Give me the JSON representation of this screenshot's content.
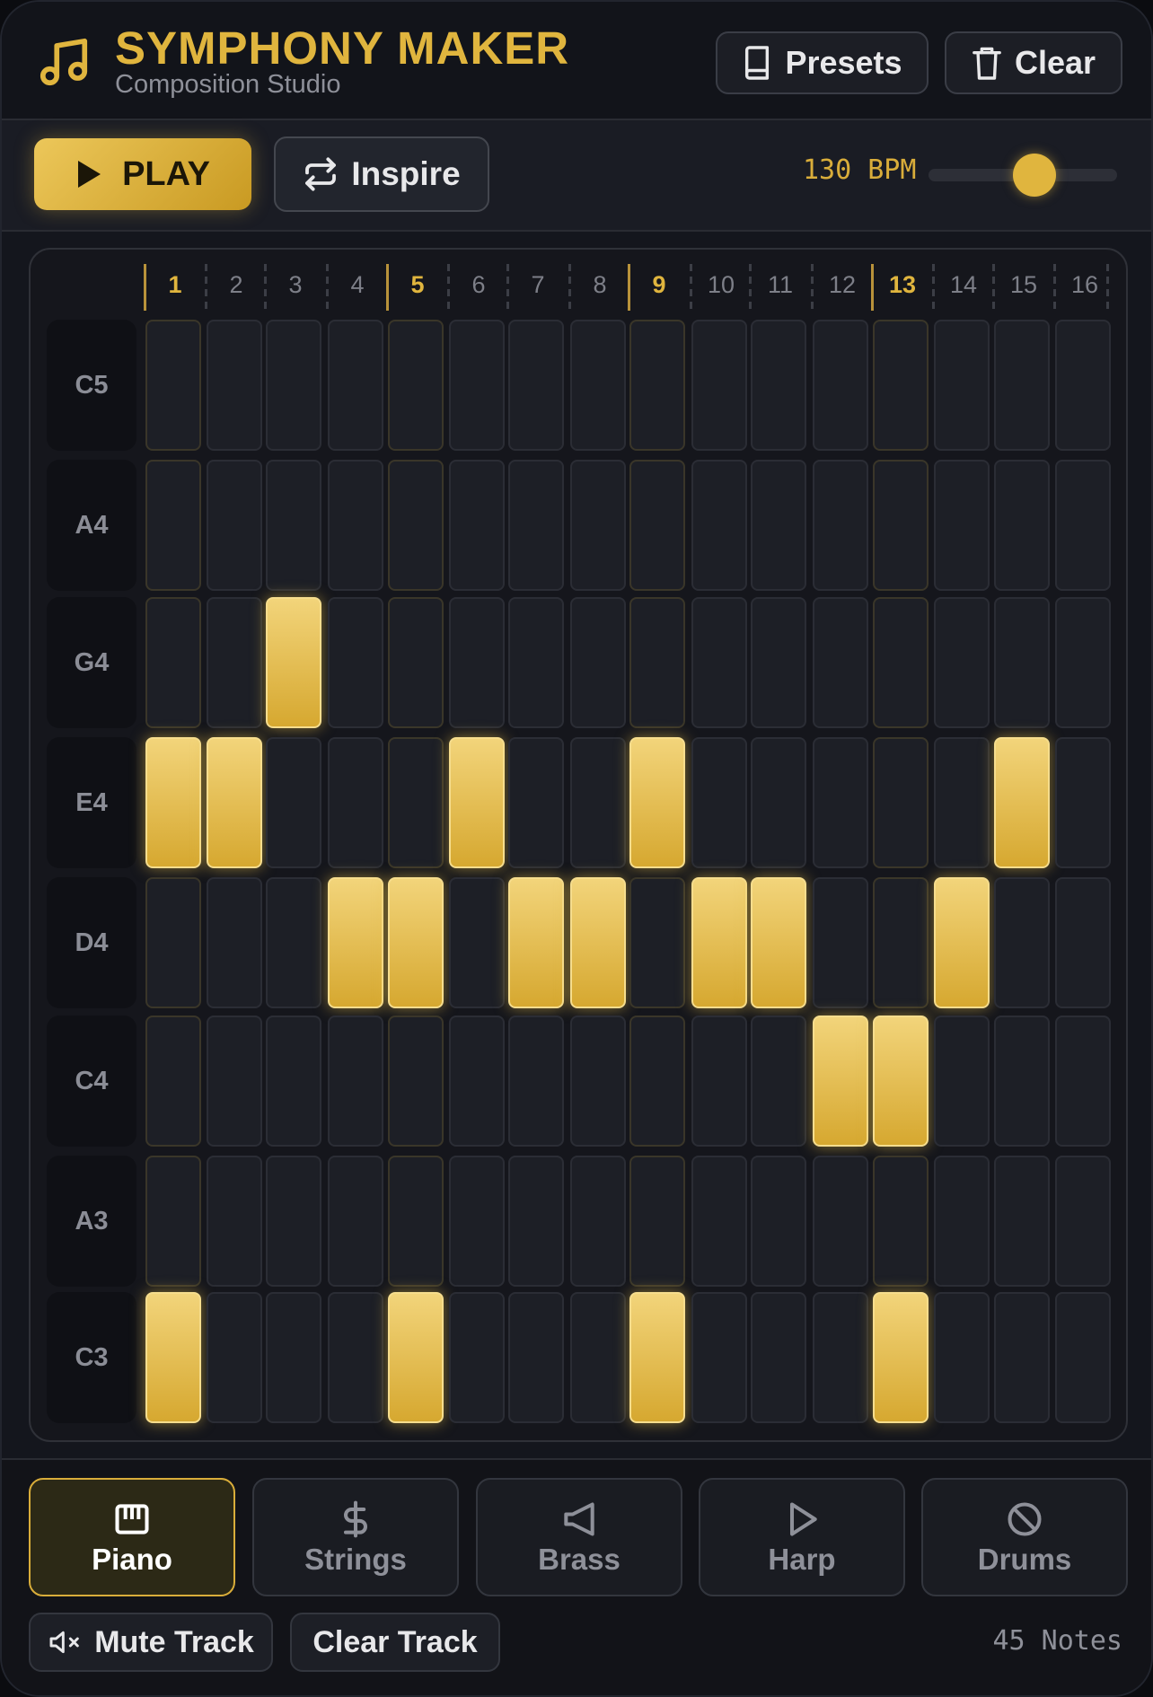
{
  "app": {
    "title": "SYMPHONY MAKER",
    "subtitle": "Composition Studio",
    "logo_icon": "music-note-icon",
    "accent_color": "#e0b53e"
  },
  "header_buttons": {
    "presets": {
      "label": "Presets",
      "icon": "book-icon"
    },
    "clear": {
      "label": "Clear",
      "icon": "trash-icon"
    }
  },
  "toolbar": {
    "play_label": "PLAY",
    "inspire_label": "Inspire",
    "bpm_label": "130 BPM",
    "tempo_fraction": 0.56
  },
  "sequencer": {
    "steps": [
      "1",
      "2",
      "3",
      "4",
      "5",
      "6",
      "7",
      "8",
      "9",
      "10",
      "11",
      "12",
      "13",
      "14",
      "15",
      "16"
    ],
    "accent_steps": [
      1,
      5,
      9,
      13
    ],
    "rows": [
      {
        "note": "C5",
        "active": []
      },
      {
        "note": "A4",
        "active": []
      },
      {
        "note": "G4",
        "active": [
          3
        ]
      },
      {
        "note": "E4",
        "active": [
          1,
          2,
          6,
          9,
          15
        ]
      },
      {
        "note": "D4",
        "active": [
          4,
          5,
          7,
          8,
          10,
          11,
          14
        ]
      },
      {
        "note": "C4",
        "active": [
          12,
          13
        ]
      },
      {
        "note": "A3",
        "active": []
      },
      {
        "note": "C3",
        "active": [
          1,
          5,
          9,
          13
        ]
      }
    ]
  },
  "instruments": [
    {
      "label": "Piano",
      "icon": "piano-icon",
      "active": true
    },
    {
      "label": "Strings",
      "icon": "dollar-icon",
      "active": false
    },
    {
      "label": "Brass",
      "icon": "horn-icon",
      "active": false
    },
    {
      "label": "Harp",
      "icon": "triangle-play-icon",
      "active": false
    },
    {
      "label": "Drums",
      "icon": "ban-icon",
      "active": false
    }
  ],
  "track_controls": {
    "mute_label": "Mute Track",
    "clear_label": "Clear Track",
    "notes_count": "45 Notes"
  }
}
